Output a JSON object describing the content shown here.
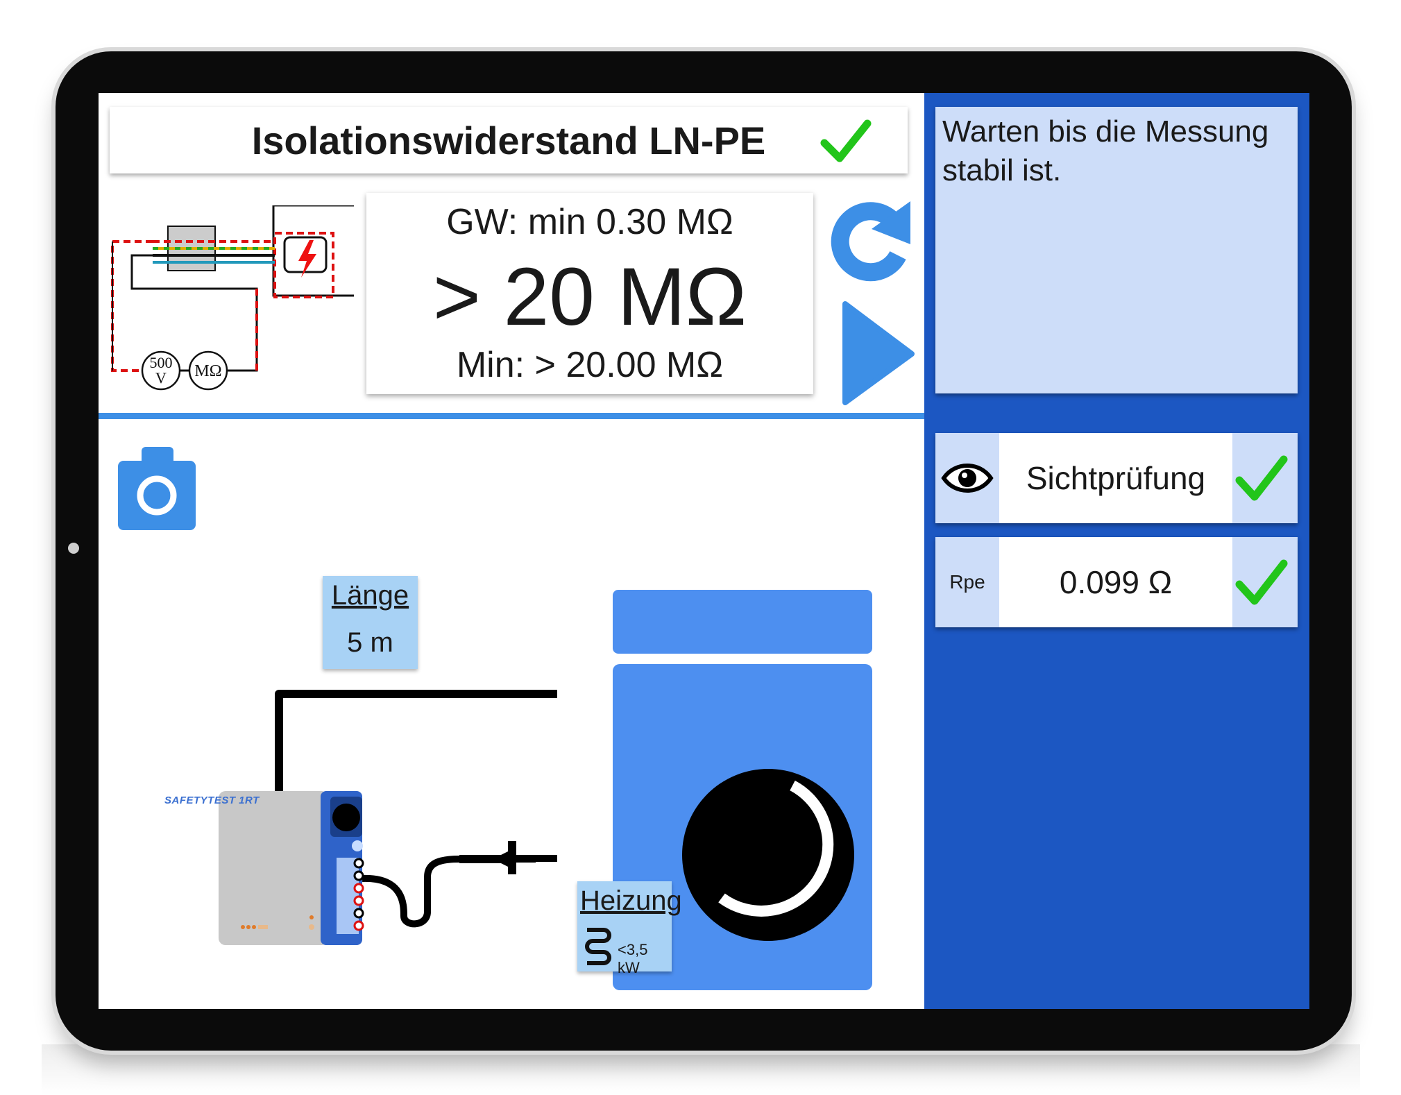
{
  "test": {
    "title": "Isolationswiderstand LN-PE",
    "limit": "GW: min 0.30 MΩ",
    "value": "> 20 MΩ",
    "minimum": "Min: > 20.00 MΩ"
  },
  "schematic": {
    "voltage_source": "500\nV",
    "voltage_top": "500",
    "voltage_bottom": "V",
    "meter": "MΩ"
  },
  "message": {
    "text": "Warten bis die Messung stabil ist."
  },
  "checks": [
    {
      "icon": "eye-icon",
      "label": "Sichtprüfung",
      "status": "ok"
    },
    {
      "icon": "Rpe",
      "label": "0.099 Ω",
      "status": "ok"
    }
  ],
  "cable": {
    "label": "Länge",
    "value": "5 m"
  },
  "heater": {
    "label": "Heizung",
    "power": "<3,5 kW"
  },
  "device": {
    "name": "SAFETYTEST 1RT"
  },
  "colors": {
    "accent_blue": "#3d8fe6",
    "panel_blue": "#1c57c2",
    "check_green": "#22c51a",
    "appliance_blue": "#4d8ff0",
    "light_panel": "#cdddf9"
  }
}
